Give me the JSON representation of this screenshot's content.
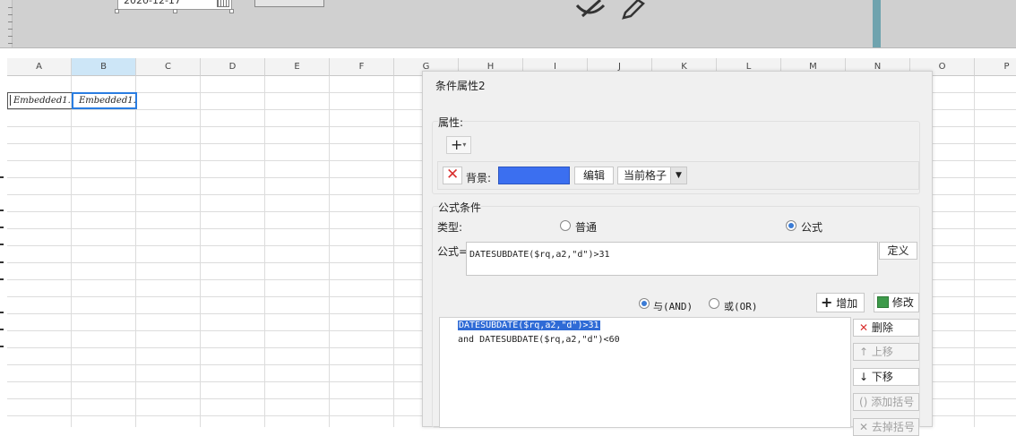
{
  "top": {
    "date_value": "2020-12-17"
  },
  "grid": {
    "columns": [
      "A",
      "B",
      "C",
      "D",
      "E",
      "F",
      "G",
      "H",
      "I",
      "J",
      "K",
      "L",
      "M",
      "N",
      "O",
      "P"
    ],
    "cell_a1": "Embedded1.",
    "cell_b1": "Embedded1."
  },
  "dialog": {
    "title": "条件属性2",
    "attributes_label": "属性:",
    "add_symbol": "+",
    "background_label": "背景:",
    "background_color": "#3b6ff0",
    "edit_button": "编辑",
    "scope_select": "当前格子",
    "formula_condition_label": "公式条件",
    "type_label": "类型:",
    "type_normal": "普通",
    "type_formula": "公式",
    "type_selected": "公式",
    "formula_label": "公式=",
    "formula_value": "DATESUBDATE($rq,a2,\"d\")>31",
    "define_button": "定义",
    "and_label": "与(AND)",
    "or_label": "或(OR)",
    "logic_selected": "AND",
    "add_button": "增加",
    "modify_button": "修改",
    "conditions": [
      "DATESUBDATE($rq,a2,\"d\")>31",
      "and DATESUBDATE($rq,a2,\"d\")<60"
    ],
    "delete_button": "删除",
    "move_up_button": "上移",
    "move_down_button": "下移",
    "add_bracket_button": "添加括号",
    "remove_bracket_button": "去掉括号"
  }
}
